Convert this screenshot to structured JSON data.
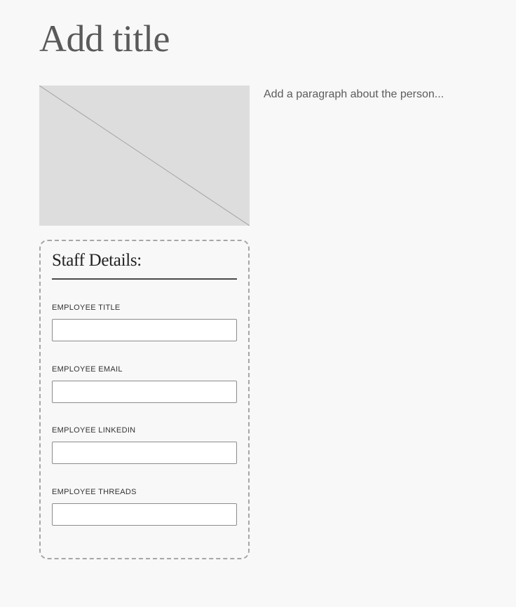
{
  "page": {
    "title": "Add title",
    "paragraph": "Add a paragraph about the person..."
  },
  "image": {
    "icon": "image-placeholder-icon",
    "background": "#dddddd"
  },
  "staff_details": {
    "heading": "Staff Details:",
    "fields": [
      {
        "label": "EMPLOYEE TITLE",
        "value": ""
      },
      {
        "label": "EMPLOYEE EMAIL",
        "value": ""
      },
      {
        "label": "EMPLOYEE LINKEDIN",
        "value": ""
      },
      {
        "label": "EMPLOYEE THREADS",
        "value": ""
      }
    ]
  }
}
